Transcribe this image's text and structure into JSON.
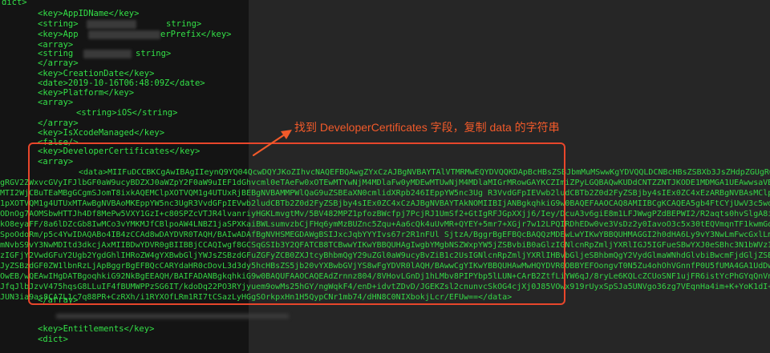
{
  "code": {
    "line_dict": "dict>",
    "line_key_app_id_name": "<key>AppIDName</key>",
    "line_string_1": "<string>",
    "line_string_1_tail": "string>",
    "line_key_app_prefix": "<key>App",
    "line_key_app_prefix_tail": "erPrefix</key>",
    "line_array_open_1": "<array>",
    "line_string_2": "<string",
    "line_string_2_tail": "string>",
    "line_array_close_1": "</array>",
    "line_key_creation_date": "<key>CreationDate</key>",
    "line_date": "<date>2019-10-16T06:48:09Z</date>",
    "line_key_platform": "<key>Platform</key>",
    "line_array_open_2": "<array>",
    "line_string_ios": "<string>iOS</string>",
    "line_array_close_2": "</array>",
    "line_key_isxcodemanaged": "<key>IsXcodeManaged</key>",
    "line_false": "<false/>",
    "line_key_dev_certs": "<key>DeveloperCertificates</key>",
    "line_array_open_3": "<array>",
    "line_data_open": "<data>MIIFuDCCBKCgAwIBAgIIeynQ9YQ04QcwDQYJKoZIhvcNAQEFBQAwgZYxCzAJBgNVBAYTAlVTMRMwEQYDVQQKDApBcHBsZSBJbmMuMSwwKgYDVQQLDCNBcHBsZSBXb3JsZHdpZGUgRGV2ZWxvcGVyIFJlbGF0aW9ucz",
    "blob_lines": [
      "gRGV2ZWxvcGVyIFJlbGF0aW9ucyBDZXJ0aWZpY2F0aW9uIEF1dGhvcml0eTAeFw0xOTEwMTYwNjM4MDlaFw0yMDEwMTUwNjM4MDlaMIGrMRowGAYKCZImiZPyLGQBAQwKUDdCNTZZNTJKODE1MDMGA1UEAwwsaVBob25lIERpc3RyaWJ1dGlvbjogWWFuIExpIChQN0I1Nlk1Mko4KTETMBEGA1UECwwKUDdCNTZZNTJKODE",
      "MTI2WjCBuTEaMBgGCgmSJomT8ixkAQEMClpXOTVQM1g4UTUxRjBEBgNVBAMMPWlQaG9uZSBEaXN0cmlidXRpb246IEppYW5nc3Ug R3VvdGFpIEVwb2ludCBTb2Z0d2FyZSBjby4sIEx0ZC4xEzARBgNVBAsMClpXOTVQM1g4UTUxMTAwLgYDVQQKDCdKaWFuZ3N1IEd1b3RhaSBFcG9pbnQgU29mdHdhcmUgY28uLCBMdGQu",
      "1pXOTVQM1g4UTUxMTAwBgNVBAoMKEppYW5nc3UgR3VvdGFpIEVwb2ludCBTb2Z0d2FyZSBjby4sIEx0ZC4xCzAJBgNVBAYTAkNOMIIBIjANBgkqhkiG9w0BAQEFAAOCAQ8AMIIBCgKCAQEA5gb4FtCYjUwV3c5wd0Ij1x4PZw",
      "ODnOg7AOMSbwHTTJh4Df8MePw5VXY1GzI+c80SPZcVTJR4lvanriyHGKLmvgtMv/5BV482MPZ1pfozBWcfpj7PcjRJ1UmSf2+GtIgRFJGpXXjj6/Iey/DcuA3v6giE8m1LFJWwgPZdBEPWI2/R2aqts0hvSlgA8iLl9",
      "kO8eyaFF/8a6lDZcGb8IwMCo3vYMKMJfCBlpoAW4LNBZ1jaSPXKaiBWLsumvzbCjFHq6ymMzBUZnc5Zqu+Aa6cQk4uUvMR+QYEY+5mr7+XGjr7w12LPQIRDhEDw0ve3VsDz2y0IavoO3c5x30tEQVmqnTF1kwmGqM9n1Sd",
      "SpoOdoRm/p5c4YwIDAQABo4IB4zCCAd8wDAYDVR0TAQH/BAIwADAfBgNVHSMEGDAWgBSIJxcJqbYYYIvs67r2R1nFUl SjtzA/BggrBgEFBQcBAQQzMDEwLwYIKwYBBQUHMAGGI2h0dHA6Ly9vY3NwLmFwcGxlLmNvb",
      "mNvbS9vY3NwMDItd3dkcjAxMIIBDwYDVR0gBIIBBjCCAQIwgf8GCSqGSIb3Y2QFATCB8TCBwwYIKwYBBQUHAgIwgbYMgbNSZWxpYW5jZSBvbiB0aGlzIGNlcnRpZmljYXRlIGJ5IGFueSBwYXJ0eSBhc3N1bWVzIGFj",
      "zIGFjY2VwdGFuY2Ugb2YgdGhlIHRoZW4gYXBwbGljYWJsZSBzdGFuZGFyZCB0ZXJtcyBhbmQgY29uZGl0aW9ucyBvZiB1c2UsIGNlcnRpZmljYXRlIHBvbGljeSBhbmQgY2VydGlmaWNhdGlvbiBwcmFjdGljZSBzdGF0",
      "JyZSBzdGF0ZW1lbnRzLjApBggrBgEFBQcCARYdaHR0cDovL3d3dy5hcHBsZS5jb20vYXBwbGVjYS8wFgYDVR0lAQH/BAwwCgYIKwYBBQUHAwMwHQYDVR0OBBYEFOongvT0N5Zu4ohOhVGnnfP0U5fUMA4GA1UdDwEB",
      "OwEB/wQEAwIHgDATBgoqhkiG92NkBgEEAQH/BAIFADANBgkqhkiG9w0BAQUFAAOCAQEAdZrnnz804/8VHovLGnDj1hLMbv8PIPYbp5lLUN+CArB2ZtfLiYW6qJ/8ryLe6KQLcZCUoSNF1ujFR6istYcPhGYqQnVnC",
      "JfqJlbJzvV475hqsG8LLuIF4fBUMWPPzSG6IT/kdoDq22PO3RYjyuem9owMs25hGY/ngWqkF4/enD+idvtZDvD/JGEKZsl2cnunvcSkOG4cjXj0J85VOwx919rUyxSpSJa5UNVgo36zg7VEqnHa4im+K+YoK1dI+NKxPn",
      "JUN3ia9as8CA7L1c7q88PR+CzRXh/i1RYXOfLRm1RI7tCSazLyHGgSOrkpxHn1H5QypCNr1mb74/dHN8C0NIXbokjLcr/EFUw==</data>"
    ],
    "line_array_close_3": "</array>",
    "line_key_entitlements": "<key>Entitlements</key>",
    "line_dict_open": "<dict>"
  },
  "annotation": {
    "text": "找到 DeveloperCertificates 字段，复制 data 的字符串",
    "color": "#f25a2a"
  },
  "colors": {
    "code_green": "#33e047",
    "highlight_red": "#e8462b",
    "left_pane_bg": "#141414",
    "right_pane_bg": "#262626"
  }
}
